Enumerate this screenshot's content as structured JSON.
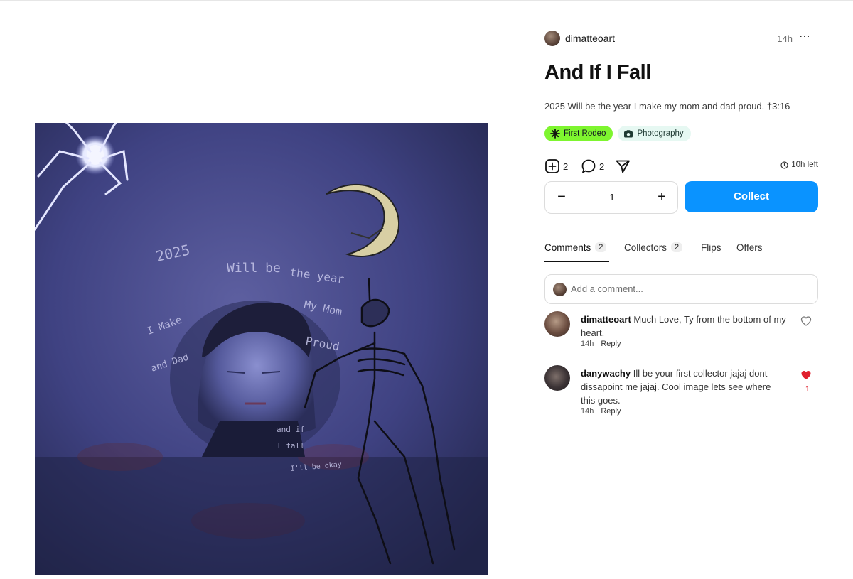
{
  "post": {
    "author": "dimatteoart",
    "time": "14h",
    "more_icon": "ellipsis-horizontal-icon",
    "title": "And If I Fall",
    "description": "2025 Will be the year I make my mom and dad proud. †3:16"
  },
  "artwork": {
    "handwritten_text": [
      "2025",
      "Will be",
      "the year",
      "I Make",
      "My Mom",
      "and Dad",
      "Proud",
      "and if",
      "I fall",
      "I'll be okay"
    ],
    "colors": {
      "background": "#3b3f7a",
      "accent": "#d8cfa4"
    }
  },
  "tags": [
    {
      "label": "First Rodeo",
      "icon": "sparkle-icon",
      "color": "#7ef52f"
    },
    {
      "label": "Photography",
      "icon": "camera-icon",
      "color": "#e6f8f2"
    }
  ],
  "stats": {
    "collects": "2",
    "comments": "2",
    "time_left": "10h left"
  },
  "purchase": {
    "quantity": "1",
    "minus_label": "−",
    "plus_label": "+",
    "collect_label": "Collect",
    "collect_color": "#0a93ff"
  },
  "tabs": [
    {
      "label": "Comments",
      "count": "2",
      "active": true
    },
    {
      "label": "Collectors",
      "count": "2"
    },
    {
      "label": "Flips"
    },
    {
      "label": "Offers"
    }
  ],
  "comment_input": {
    "placeholder": "Add a comment..."
  },
  "comments": [
    {
      "user": "dimatteoart",
      "text": "Much Love, Ty from the bottom of my heart.",
      "time": "14h",
      "reply_label": "Reply",
      "liked": false
    },
    {
      "user": "danywachy",
      "text": "Ill be your first collector jajaj dont dissapoint me jajaj. Cool image lets see where this goes.",
      "time": "14h",
      "reply_label": "Reply",
      "liked": true,
      "likes": "1"
    }
  ]
}
